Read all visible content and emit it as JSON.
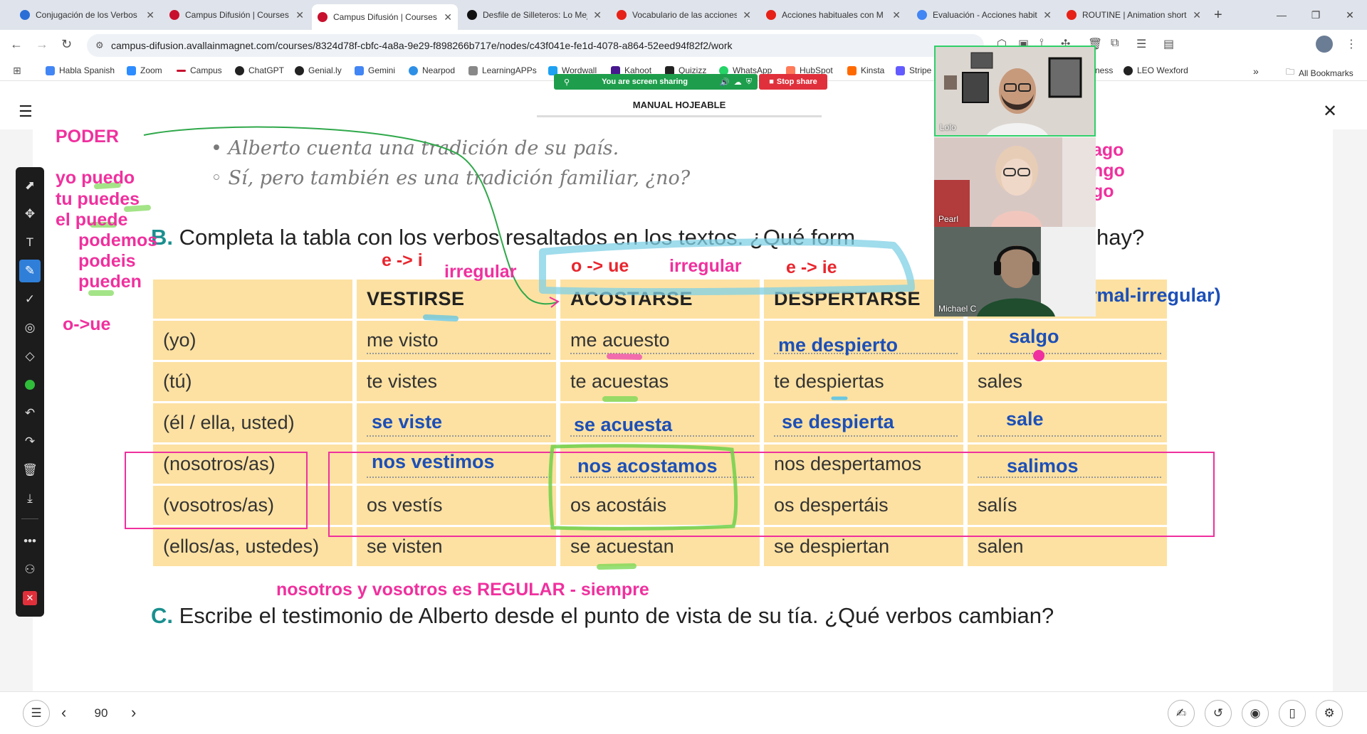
{
  "tabs": [
    {
      "title": "Conjugación de los Verbos",
      "color": "#2b6fd6"
    },
    {
      "title": "Campus Difusión | Courses",
      "color": "#c8102e"
    },
    {
      "title": "Campus Difusión | Courses",
      "color": "#c8102e"
    },
    {
      "title": "Desfile de Silleteros: Lo Mejor",
      "color": "#111111"
    },
    {
      "title": "Vocabulario de las acciones",
      "color": "#e62117"
    },
    {
      "title": "Acciones habituales con M",
      "color": "#e62117"
    },
    {
      "title": "Evaluación - Acciones habituales",
      "color": "#4285f4"
    },
    {
      "title": "ROUTINE | Animation short",
      "color": "#e62117"
    }
  ],
  "new_tab": "+",
  "url": "campus-difusion.avallainmagnet.com/courses/8324d78f-cbfc-4a8a-9e29-f898266b717e/nodes/c43f041e-fe1d-4078-a864-52eed94f82f2/work",
  "bookmarks": [
    {
      "label": "Habla Spanish",
      "color": "#4285f4"
    },
    {
      "label": "Zoom",
      "color": "#2d8cff"
    },
    {
      "label": "Campus",
      "color": "#c8102e"
    },
    {
      "label": "ChatGPT",
      "color": "#222222"
    },
    {
      "label": "Genial.ly",
      "color": "#222222"
    },
    {
      "label": "Gemini",
      "color": "#4285f4"
    },
    {
      "label": "Nearpod",
      "color": "#2e8fe6"
    },
    {
      "label": "LearningAPPs",
      "color": "#888888"
    },
    {
      "label": "Wordwall",
      "color": "#1da1f2"
    },
    {
      "label": "Kahoot",
      "color": "#46178f"
    },
    {
      "label": "Quizizz",
      "color": "#222222"
    },
    {
      "label": "WhatsApp",
      "color": "#25d366"
    },
    {
      "label": "HubSpot",
      "color": "#ff7a59"
    },
    {
      "label": "Kinsta",
      "color": "#ff6a00"
    },
    {
      "label": "Stripe",
      "color": "#635bff"
    },
    {
      "label": "ness",
      "color": "#ffffff"
    },
    {
      "label": "LEO Wexford",
      "color": "#222222"
    }
  ],
  "bookmarks_more": "»",
  "all_bookmarks": "All Bookmarks",
  "share": {
    "status": "You are screen sharing",
    "stop": "Stop share"
  },
  "header": {
    "title": "MANUAL HOJEABLE"
  },
  "content": {
    "line1": "• Alberto cuenta una tradición de su país.",
    "line2": "◦ Sí, pero también es una tradición familiar, ¿no?",
    "b_letter": "B.",
    "b_text": "Completa la tabla con los verbos resaltados en los textos. ¿Qué form",
    "b_text_end": "hay?",
    "c_letter": "C.",
    "c_text": "Escribe el testimonio de Alberto desde el punto de vista de su tía. ¿Qué verbos cambian?"
  },
  "table": {
    "headers": [
      "",
      "VESTIRSE",
      "ACOSTARSE",
      "DESPERTARSE",
      ""
    ],
    "rows": [
      [
        "(yo)",
        "me visto",
        "me acuesto",
        "",
        ""
      ],
      [
        "(tú)",
        "te vistes",
        "te acuestas",
        "te despiertas",
        "sales"
      ],
      [
        "(él / ella, usted)",
        "",
        "",
        "",
        ""
      ],
      [
        "(nosotros/as)",
        "",
        "",
        "nos despertamos",
        ""
      ],
      [
        "(vosotros/as)",
        "os vestís",
        "os acostáis",
        "os despertáis",
        "salís"
      ],
      [
        "(ellos/as, ustedes)",
        "se visten",
        "se acuestan",
        "se despiertan",
        "salen"
      ]
    ]
  },
  "annotations": {
    "poder": "PODER",
    "yo_puedo": "yo puedo",
    "tu_puedes": "tu puedes",
    "el_puede": "el puede",
    "podemos": "podemos",
    "podeis": "podeis",
    "pueden": "pueden",
    "o_ue_left": "o->ue",
    "e_i": "e -> i",
    "irregular1": "irregular",
    "o_ue": "o -> ue",
    "irregular2": "irregular",
    "e_ie": "e -> ie",
    "right_ago": "ago",
    "right_ngo": "ngo",
    "right_go": "go",
    "rmal_irregular": "rmal-irregular)",
    "me_despierto": "me despierto",
    "salgo": "salgo",
    "se_viste": "se viste",
    "se_acuesta": "se acuesta",
    "se_despierta": "se despierta",
    "sale": "sale",
    "nos_vestimos": "nos vestimos",
    "nos_acostamos": "nos acostamos",
    "salimos": "salimos",
    "regular_note": "nosotros y vosotros es REGULAR - siempre"
  },
  "participants": [
    {
      "name": "Lolo"
    },
    {
      "name": "Pearl"
    },
    {
      "name": "Michael C"
    }
  ],
  "pager": {
    "page": "90"
  }
}
